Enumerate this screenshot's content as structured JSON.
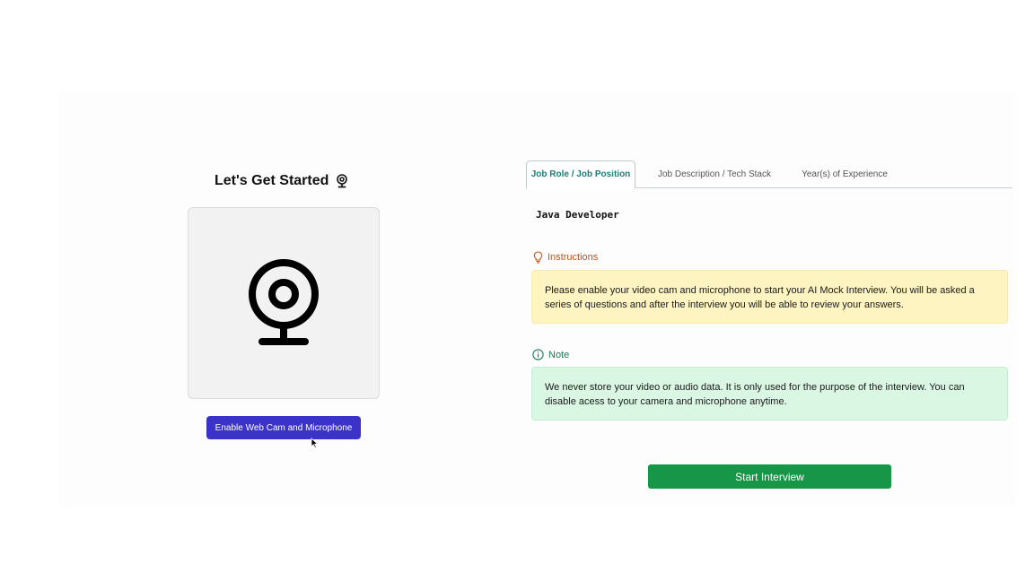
{
  "left": {
    "title": "Let's Get Started",
    "title_icon": "webcam-icon",
    "camera_placeholder_icon": "webcam-icon",
    "enable_button": "Enable Web Cam and Microphone",
    "enable_button_color": "#3b33c9"
  },
  "tabs": [
    {
      "label": "Job Role / Job Position",
      "active": true
    },
    {
      "label": "Job Description / Tech Stack",
      "active": false
    },
    {
      "label": "Year(s) of Experience",
      "active": false
    }
  ],
  "active_tab_content": "Java Developer",
  "instructions": {
    "icon": "lightbulb-icon",
    "label": "Instructions",
    "text": "Please enable your video cam and microphone to start your AI Mock Interview. You will be asked a series of questions and after the interview you will be able to review your answers.",
    "color": "#fdf4c1"
  },
  "note": {
    "icon": "info-icon",
    "label": "Note",
    "text": "We never store your video or audio data. It is only used for the purpose of the interview. You can disable acess to your camera and microphone anytime.",
    "color": "#d9f7e2"
  },
  "start_button": "Start Interview",
  "start_button_color": "#169646"
}
